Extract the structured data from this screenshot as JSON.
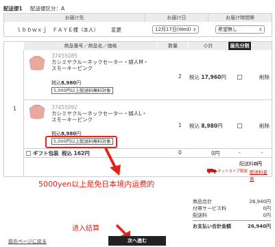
{
  "delivery": {
    "title": "配送便1",
    "category_label": "配送便区分：A"
  },
  "shipping_header": {
    "destination": "お届け先",
    "date": "お届け日",
    "time": "お届け時間帯"
  },
  "shipping_row": {
    "recipient": "ｌｂｂｗｘｊ　ＦＡＹＥ様（本人）",
    "change": "変更",
    "date_value": "12月17日(Wed)",
    "time_value": "希望無し"
  },
  "items_header": {
    "product": "商品番号／商品名／価格",
    "qty": "数量",
    "subtotal": "小計",
    "split": "届先分割"
  },
  "row_number": "1",
  "items": [
    {
      "sku": "37455085",
      "name": "カシミヤクルーネックセーター・婦人M・スモーキーピンク",
      "price_label": "税込",
      "price": "8,980",
      "price_unit": "円",
      "note": "5,000円以上配送料無料対象",
      "qty": "2",
      "subtotal_prefix": "税込",
      "subtotal": "17,960",
      "subtotal_unit": "円",
      "delete": "削除"
    },
    {
      "sku": "37455092",
      "name": "カシミヤクルーネックセーター・婦人L・スモーキーピンク",
      "price_label": "税込",
      "price": "8,980",
      "price_unit": "円",
      "note": "5,000円以上配送料無料対象",
      "qty": "1",
      "subtotal_prefix": "税込",
      "subtotal": "8,980",
      "subtotal_unit": "円",
      "delete": "削除"
    }
  ],
  "gift": {
    "label": "ギフト包装",
    "price": "税込 162円",
    "qty": "0",
    "subtotal": "0円",
    "dash1": "-",
    "dash2": "-"
  },
  "shipping_fee": {
    "label": "配送料",
    "value": "0円",
    "store_text": "ネットストア配送",
    "fee_link": "配送料金表"
  },
  "annotations": {
    "free_shipping": "5000yen以上是免日本境内运费的",
    "proceed": "进入结算"
  },
  "summary": {
    "rows": [
      {
        "label": "商品合計",
        "value": "26,940円"
      },
      {
        "label": "付帯サービス料",
        "value": "0円"
      },
      {
        "label": "配送料",
        "value": "0円"
      }
    ],
    "total_label": "お支払い合計金額",
    "total_value": "26,940円"
  },
  "footer": {
    "back_link": "前のページに戻る",
    "next_button": "次へ進む"
  },
  "colors": {
    "annotation_red": "#e0241b",
    "header_gray": "#ececec",
    "split_header_bg": "#222222",
    "sweater_pink": "#e9a8a0"
  }
}
